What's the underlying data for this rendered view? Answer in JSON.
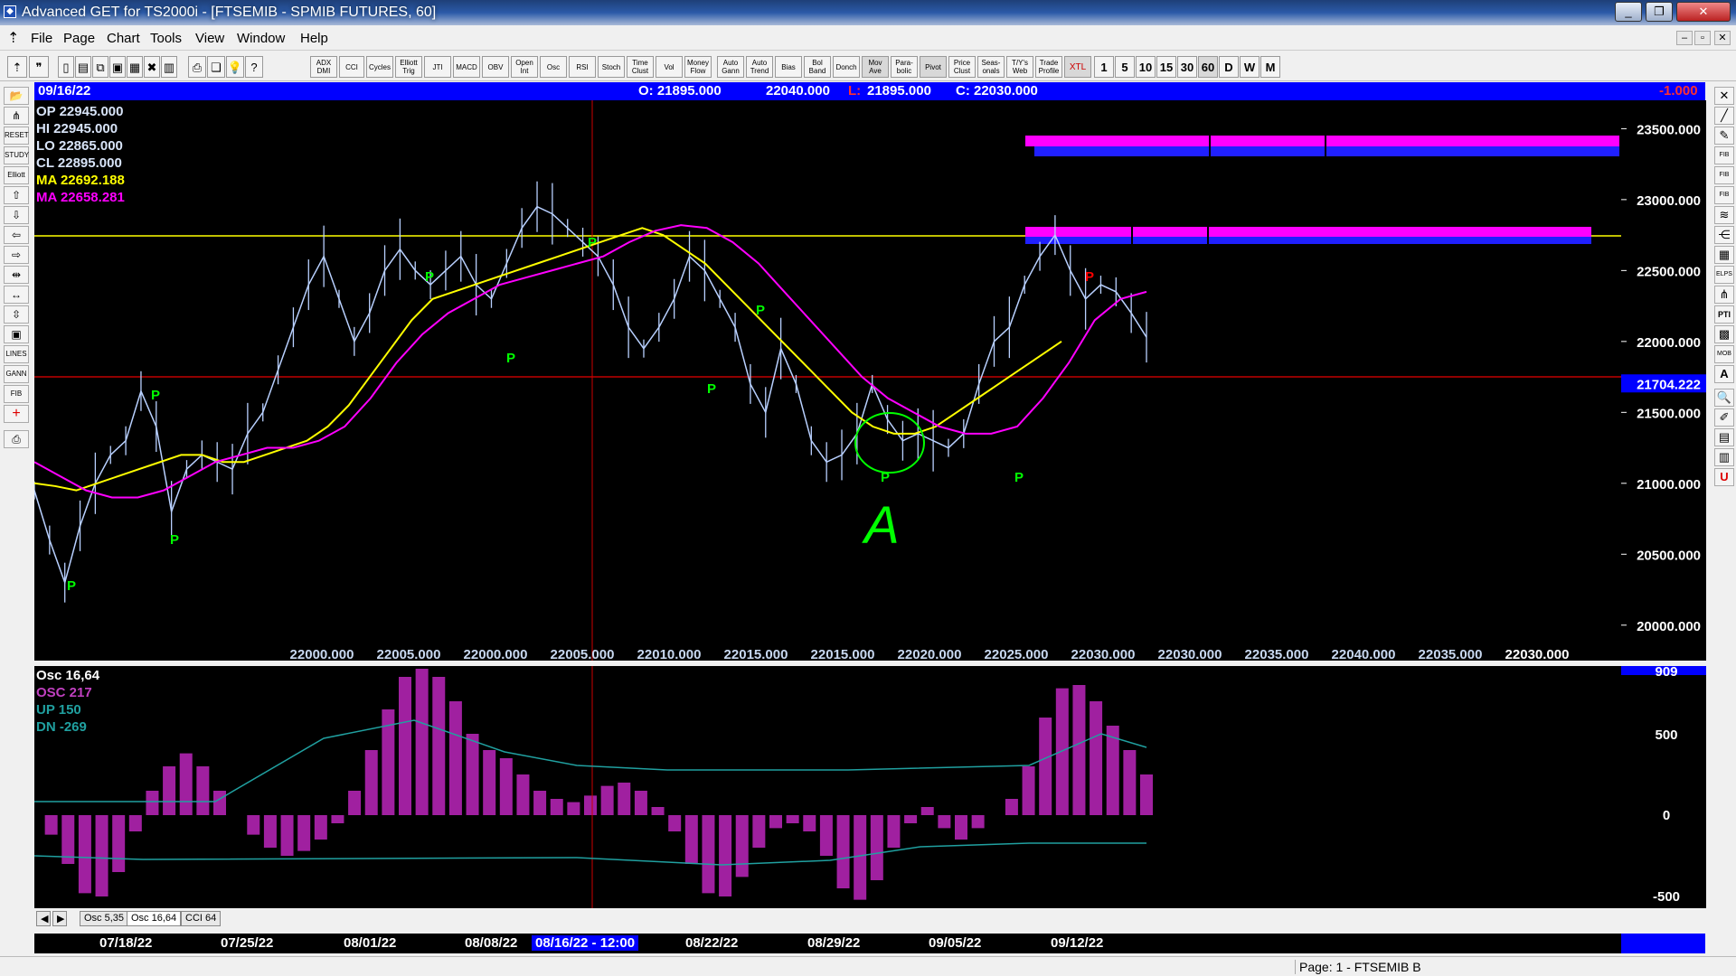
{
  "window": {
    "title": "Advanced GET for TS2000i - [FTSEMIB - SPMIB FUTURES, 60]",
    "min": "_",
    "max": "❐",
    "close": "✕"
  },
  "menu": [
    "File",
    "Page",
    "Chart",
    "Tools",
    "View",
    "Window",
    "Help"
  ],
  "toolbar": {
    "studies": [
      "ADX DMI",
      "CCI",
      "Cycles",
      "Elliott Trig",
      "JTI",
      "MACD",
      "OBV",
      "Open Int",
      "Osc",
      "RSI",
      "Stoch",
      "Time Clust",
      "Vol",
      "Money Flow",
      "Auto Gann",
      "Auto Trend",
      "Bias",
      "Bol Band",
      "Donch",
      "Mov Ave",
      "Para-bolic",
      "Pivot",
      "Price Clust",
      "Seas-onals",
      "T/Y's Web",
      "Trade Profile",
      "XTL"
    ],
    "periods": [
      "1",
      "5",
      "10",
      "15",
      "30",
      "60",
      "D",
      "W",
      "M"
    ]
  },
  "info": {
    "date": "09/16/22",
    "open": "O: 21895.000",
    "high": "22040.000",
    "low_label": "L:",
    "low": "21895.000",
    "close": "C: 22030.000",
    "change": "-1.000"
  },
  "legend": {
    "op": "OP  22945.000",
    "hi": "HI   22945.000",
    "lo": "LO  22865.000",
    "cl": "CL  22895.000",
    "ma1": "MA  22692.188",
    "ma2": "MA  22658.281"
  },
  "price_scale": [
    "23500.000",
    "23000.000",
    "22500.000",
    "22000.000",
    "21500.000",
    "21000.000",
    "20500.000",
    "20000.000"
  ],
  "price_marker": "21704.222",
  "xtl_labels": [
    "22000.000",
    "22005.000",
    "22000.000",
    "22005.000",
    "22010.000",
    "22015.000",
    "22015.000",
    "22020.000",
    "22025.000",
    "22030.000",
    "22030.000",
    "22035.000",
    "22040.000",
    "22035.000",
    "22030.000"
  ],
  "pivot_label": "P",
  "annotation_letter": "A",
  "osc_legend": {
    "title": "Osc 16,64",
    "osc": "OSC 217",
    "up": "UP   150",
    "dn": "DN   -269"
  },
  "osc_scale": [
    "909",
    "500",
    "0",
    "-500"
  ],
  "tabs": [
    "Osc 5,35",
    "Osc 16,64",
    "CCI 64"
  ],
  "dates": [
    "07/18/22",
    "07/25/22",
    "08/01/22",
    "08/08/22",
    "08/16/22 - 12:00",
    "08/22/22",
    "08/29/22",
    "09/05/22",
    "09/12/22"
  ],
  "status": "Page: 1 - FTSEMIB B",
  "colors": {
    "ma_yellow": "#ffff00",
    "ma_magenta": "#ff00ff",
    "pivot_green": "#00ff00",
    "info_blue": "#0000ff",
    "cursor_red": "#cc0000"
  },
  "chart_data": {
    "type": "line",
    "series": [
      {
        "values": [
          20950,
          20600,
          20300,
          20700,
          21000,
          21200,
          21300,
          21650,
          21400,
          20800,
          21100,
          21200,
          21150,
          21100,
          21350,
          21500,
          21800,
          22100,
          22400,
          22600,
          22300,
          22000,
          22200,
          22500,
          22650,
          22500,
          22400,
          22500,
          22600,
          22400,
          22300,
          22550,
          22800,
          22950,
          22900,
          22800,
          22700,
          22600,
          22400,
          22100,
          21950,
          22100,
          22300,
          22600,
          22500,
          22300,
          22100,
          21700,
          21500,
          21950,
          21700,
          21300,
          21150,
          21200,
          21350,
          21700,
          21450,
          21300,
          21350,
          21300,
          21250,
          21350,
          21700,
          22000,
          22100,
          22400,
          22600,
          22750,
          22500,
          22300,
          22400,
          22350,
          22200,
          22030
        ]
      },
      {
        "values": [
          21000,
          20980,
          20950,
          21000,
          21050,
          21100,
          21150,
          21200,
          21200,
          21150,
          21150,
          21200,
          21250,
          21300,
          21400,
          21550,
          21750,
          21950,
          22150,
          22300,
          22350,
          22400,
          22450,
          22500,
          22550,
          22600,
          22650,
          22700,
          22750,
          22800,
          22750,
          22650,
          22550,
          22400,
          22250,
          22100,
          21950,
          21800,
          21650,
          21500,
          21400,
          21350,
          21350,
          21400,
          21500,
          21600,
          21700,
          21800,
          21900,
          22000
        ]
      },
      {
        "values": [
          21150,
          21050,
          20950,
          20900,
          20900,
          20950,
          21050,
          21150,
          21200,
          21250,
          21250,
          21300,
          21400,
          21600,
          21850,
          22050,
          22200,
          22300,
          22400,
          22450,
          22500,
          22550,
          22600,
          22700,
          22780,
          22820,
          22800,
          22700,
          22550,
          22350,
          22150,
          21950,
          21750,
          21600,
          21500,
          21400,
          21350,
          21350,
          21400,
          21600,
          21850,
          22150,
          22300,
          22350
        ]
      }
    ],
    "ylim": [
      19750,
      23700
    ],
    "grid": false
  }
}
